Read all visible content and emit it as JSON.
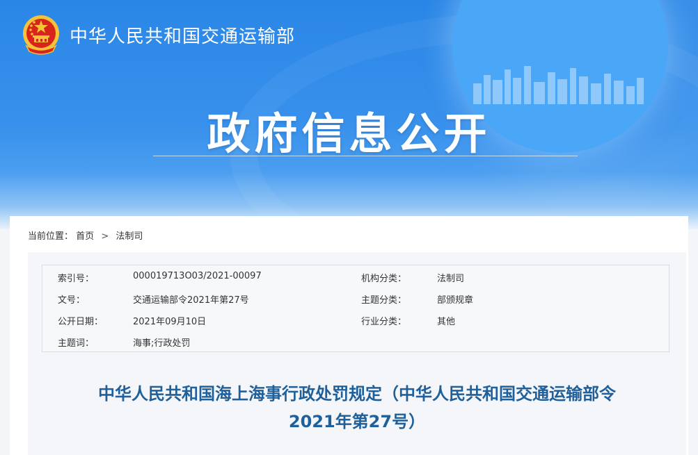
{
  "header": {
    "ministry_name": "中华人民共和国交通运输部",
    "banner_title": "政府信息公开"
  },
  "breadcrumb": {
    "prefix": "当前位置：",
    "home": "首页",
    "separator": ">",
    "current": "法制司"
  },
  "metadata": {
    "index_label": "索引号：",
    "index_value": "000019713O03/2021-00097",
    "org_label": "机构分类：",
    "org_value": "法制司",
    "doc_label": "文号：",
    "doc_value": "交通运输部令2021年第27号",
    "topic_label": "主题分类：",
    "topic_value": "部颁规章",
    "date_label": "公开日期：",
    "date_value": "2021年09月10日",
    "industry_label": "行业分类：",
    "industry_value": "其他",
    "keyword_label": "主题词：",
    "keyword_value": "海事;行政处罚"
  },
  "document": {
    "title_line1": "中华人民共和国海上海事行政处罚规定（中华人民共和国交通运输部令",
    "title_line2": "2021年第27号）"
  },
  "colors": {
    "banner_blue": "#2a86e6",
    "title_blue": "#1f5f9a",
    "emblem_red": "#d8251b",
    "emblem_gold": "#f5c23a"
  }
}
